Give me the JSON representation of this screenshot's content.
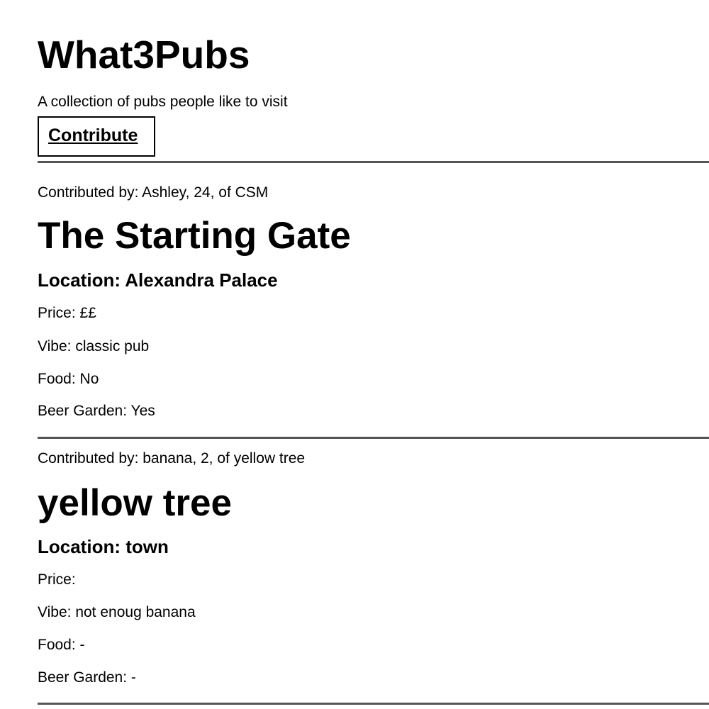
{
  "header": {
    "title": "What3Pubs",
    "tagline": "A collection of pubs people like to visit",
    "contribute_label": "Contribute"
  },
  "pubs": [
    {
      "contributed_by": "Contributed by: Ashley, 24, of CSM",
      "name": "The Starting Gate",
      "location": "Location: Alexandra Palace",
      "price": "Price: ££",
      "vibe": "Vibe: classic pub",
      "food": "Food: No",
      "beer_garden": "Beer Garden: Yes"
    },
    {
      "contributed_by": "Contributed by: banana, 2, of yellow tree",
      "name": "yellow tree",
      "location": "Location: town",
      "price": "Price:",
      "vibe": "Vibe: not enoug banana",
      "food": "Food: -",
      "beer_garden": "Beer Garden: -"
    }
  ]
}
